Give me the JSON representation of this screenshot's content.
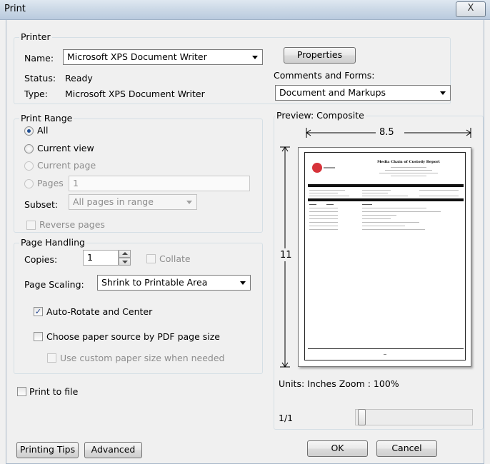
{
  "window": {
    "title": "Print",
    "close_glyph": "X"
  },
  "printer": {
    "legend": "Printer",
    "name_label": "Name:",
    "name_value": "Microsoft XPS Document Writer",
    "properties_button": "Properties",
    "status_label": "Status:",
    "status_value": "Ready",
    "type_label": "Type:",
    "type_value": "Microsoft XPS Document Writer",
    "comments_label": "Comments and Forms:",
    "comments_value": "Document and Markups"
  },
  "print_range": {
    "legend": "Print Range",
    "all": "All",
    "current_view": "Current view",
    "current_page": "Current page",
    "pages": "Pages",
    "pages_value": "1",
    "subset_label": "Subset:",
    "subset_value": "All pages in range",
    "reverse": "Reverse pages"
  },
  "page_handling": {
    "legend": "Page Handling",
    "copies_label": "Copies:",
    "copies_value": "1",
    "collate": "Collate",
    "scaling_label": "Page Scaling:",
    "scaling_value": "Shrink to Printable Area",
    "auto_rotate": "Auto-Rotate and Center",
    "auto_rotate_checked": true,
    "paper_source": "Choose paper source by PDF page size",
    "custom_paper": "Use custom paper size when needed"
  },
  "print_to_file": "Print to file",
  "preview": {
    "label": "Preview: Composite",
    "width_dim": "8.5",
    "height_dim": "11",
    "units": "Units: Inches Zoom : 100%",
    "page_counter": "1/1",
    "doc_title": "Media Chain of Custody Report"
  },
  "footer": {
    "printing_tips": "Printing Tips",
    "advanced": "Advanced",
    "ok": "OK",
    "cancel": "Cancel"
  },
  "colors": {
    "accent": "#1f4e93",
    "titlebar": "#cbd8e6",
    "logo": "#d6333a"
  }
}
